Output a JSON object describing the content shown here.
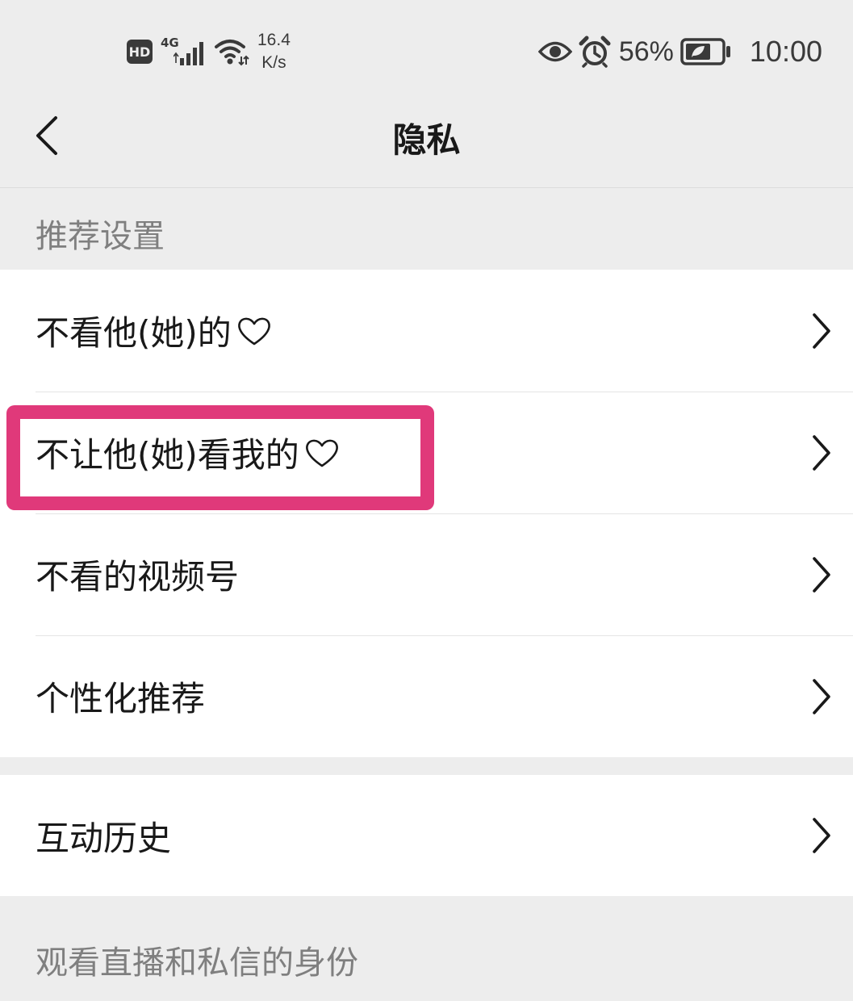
{
  "status_bar": {
    "hd_label": "HD",
    "network_type": "4G",
    "speed_value": "16.4",
    "speed_unit": "K/s",
    "battery_percent": "56%",
    "time": "10:00"
  },
  "nav": {
    "title": "隐私"
  },
  "sections": {
    "recommend_header": "推荐设置",
    "identity_header": "观看直播和私信的身份"
  },
  "recommend_items": [
    {
      "label": "不看他(她)的"
    },
    {
      "label": "不让他(她)看我的"
    },
    {
      "label": "不看的视频号"
    },
    {
      "label": "个性化推荐"
    }
  ],
  "history_items": [
    {
      "label": "互动历史"
    }
  ],
  "colors": {
    "highlight": "#e0397a",
    "background": "#ededed"
  }
}
